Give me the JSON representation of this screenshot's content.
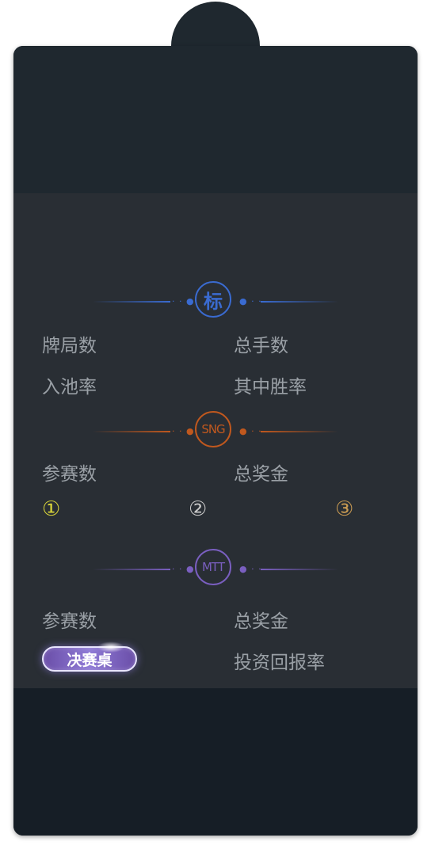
{
  "colors": {
    "biao_accent": "#3a6bd1",
    "sng_accent": "#c0581e",
    "mtt_accent": "#7a5fc0",
    "text_muted": "#9aa0a6",
    "medal_gold": "#d6d23a",
    "medal_silver": "#c8c8c8",
    "medal_bronze": "#c89a52"
  },
  "sections": {
    "biao": {
      "badge": "标",
      "stats": [
        "牌局数",
        "总手数",
        "入池率",
        "其中胜率"
      ]
    },
    "sng": {
      "badge": "SNG",
      "stats": [
        "参赛数",
        "总奖金"
      ],
      "medals": [
        "①",
        "②",
        "③"
      ]
    },
    "mtt": {
      "badge": "MTT",
      "stats": [
        "参赛数",
        "总奖金",
        "投资回报率"
      ],
      "final_table_button": "决赛桌"
    }
  }
}
